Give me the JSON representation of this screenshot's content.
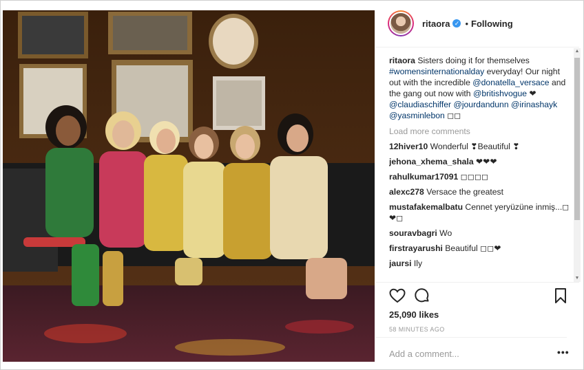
{
  "post": {
    "username": "ritaora",
    "follow_status": "Following",
    "dot": "•",
    "verified_glyph": "✓"
  },
  "caption": {
    "username": "ritaora",
    "text_1": "Sisters doing it for themselves",
    "tag_1": "#womensinternationalday",
    "text_2": "everyday! Our night out with the incredible",
    "tag_2": "@donatella_versace",
    "text_3": "and the gang out now with",
    "tag_3": "@britishvogue",
    "text_4": "❤",
    "tag_4": "@claudiaschiffer",
    "tag_5": "@jourdandunn",
    "tag_6": "@irinashayk",
    "tag_7": "@yasminlebon",
    "text_5": "◻◻"
  },
  "load_more": "Load more comments",
  "comments": [
    {
      "user": "12hiver10",
      "text": "Wonderful ❣Beautiful ❣"
    },
    {
      "user": "jehona_xhema_shala",
      "text": "❤❤❤"
    },
    {
      "user": "rahulkumar17091",
      "text": "◻◻◻◻"
    },
    {
      "user": "alexc278",
      "text": "Versace the greatest"
    },
    {
      "user": "mustafakemalbatu",
      "text": "Cennet yeryüzüne inmiş...◻❤◻"
    },
    {
      "user": "souravbagri",
      "text": "Wo"
    },
    {
      "user": "firstrayarushi",
      "text": "Beautiful ◻◻❤"
    },
    {
      "user": "jaursi",
      "text": "Ily"
    }
  ],
  "scrollbar": {
    "up": "▲",
    "down": "▼"
  },
  "likes": "25,090 likes",
  "timestamp": "58 MINUTES AGO",
  "add_comment_placeholder": "Add a comment...",
  "more_options": "•••",
  "icons": {
    "like": "heart-icon",
    "comment": "comment-icon",
    "save": "bookmark-icon"
  }
}
